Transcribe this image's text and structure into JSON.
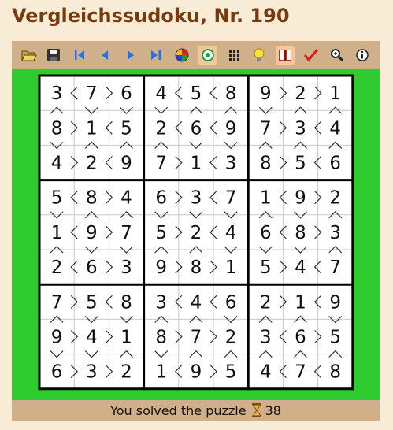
{
  "title": "Vergleichssudoku, Nr. 190",
  "toolbar": {
    "buttons": [
      {
        "name": "open-icon",
        "glyph": "folder"
      },
      {
        "name": "save-icon",
        "glyph": "disk"
      },
      {
        "name": "first-icon",
        "glyph": "first"
      },
      {
        "name": "prev-icon",
        "glyph": "prev"
      },
      {
        "name": "next-icon",
        "glyph": "next"
      },
      {
        "name": "last-icon",
        "glyph": "last"
      },
      {
        "name": "color-wheel-icon",
        "glyph": "wheel"
      },
      {
        "name": "target-icon",
        "glyph": "target"
      },
      {
        "name": "grid-dots-icon",
        "glyph": "dots"
      },
      {
        "name": "lightbulb-icon",
        "glyph": "bulb"
      },
      {
        "name": "book-icon",
        "glyph": "book"
      },
      {
        "name": "check-icon",
        "glyph": "check"
      },
      {
        "name": "zoom-icon",
        "glyph": "zoom"
      },
      {
        "name": "info-icon",
        "glyph": "info"
      }
    ],
    "active": [
      "target-icon",
      "book-icon"
    ]
  },
  "grid": [
    [
      3,
      7,
      6,
      4,
      5,
      8,
      9,
      2,
      1
    ],
    [
      8,
      1,
      5,
      2,
      6,
      9,
      7,
      3,
      4
    ],
    [
      4,
      2,
      9,
      7,
      1,
      3,
      8,
      5,
      6
    ],
    [
      5,
      8,
      4,
      6,
      3,
      7,
      1,
      9,
      2
    ],
    [
      1,
      9,
      7,
      5,
      2,
      4,
      6,
      8,
      3
    ],
    [
      2,
      6,
      3,
      9,
      8,
      1,
      5,
      4,
      7
    ],
    [
      7,
      5,
      8,
      3,
      4,
      6,
      2,
      1,
      9
    ],
    [
      9,
      4,
      1,
      8,
      7,
      2,
      3,
      6,
      5
    ],
    [
      6,
      3,
      2,
      1,
      9,
      5,
      4,
      7,
      8
    ]
  ],
  "status": {
    "text": "You solved the puzzle",
    "timer": "38"
  },
  "colors": {
    "board_bg": "#2ecc2e",
    "bar_bg": "#d0b088",
    "page_bg": "#f8ecd6",
    "title": "#7a3a10"
  }
}
